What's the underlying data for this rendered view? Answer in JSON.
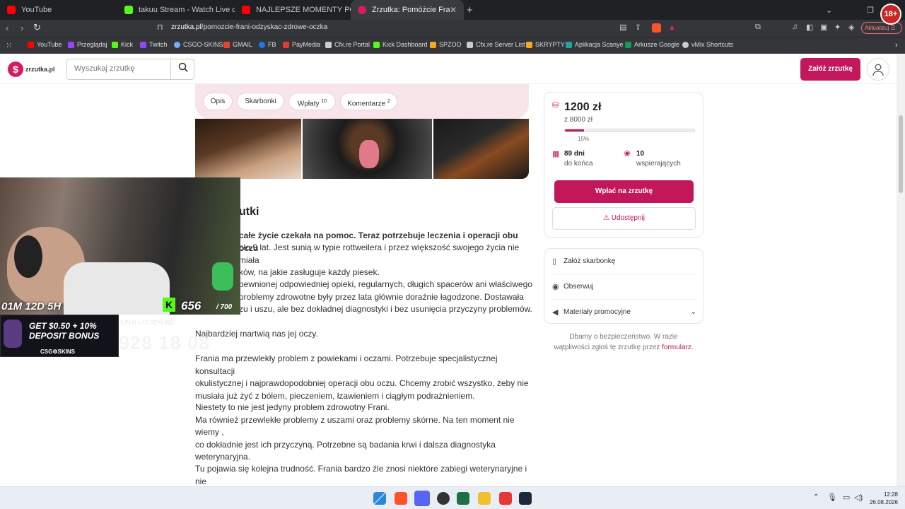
{
  "browser": {
    "tabs": [
      {
        "title": "YouTube",
        "color": "#ff0000"
      },
      {
        "title": "takuu Stream - Watch Live on Kick",
        "color": "#53fc18"
      },
      {
        "title": "NAJLEPSZE MOMENTY POLSKIEGO T",
        "color": "#ff0000"
      },
      {
        "title": "Zrzutka: Pomóżcie Frani odzysk",
        "color": "#d81b60"
      }
    ],
    "new_tab": "+",
    "url_host": "zrzutka.pl",
    "url_path": "/pomozcie-frani-odzyskac-zdrowe-oczka",
    "update_btn": "Aktualizuj",
    "age_badge": "18+",
    "bookmarks": [
      {
        "label": "YouTube",
        "color": "#ff0000"
      },
      {
        "label": "Przeglądaj",
        "color": "#9146ff"
      },
      {
        "label": "Kick",
        "color": "#53fc18"
      },
      {
        "label": "Twitch",
        "color": "#9146ff"
      },
      {
        "label": "CSGO-SKINS",
        "color": "#7aa7ff"
      },
      {
        "label": "GMAIL",
        "color": "#ea4335"
      },
      {
        "label": "FB",
        "color": "#1877f2"
      },
      {
        "label": "PayMedia",
        "color": "#e53935"
      },
      {
        "label": "Cfx.re Portal",
        "color": "#cccccc"
      },
      {
        "label": "Kick Dashboard",
        "color": "#53fc18"
      },
      {
        "label": "SPZOO",
        "color": "#f5a623"
      },
      {
        "label": "Cfx.re Server List",
        "color": "#cccccc"
      },
      {
        "label": "SKRYPTY",
        "color": "#f5a623"
      },
      {
        "label": "Aplikacja Scanye",
        "color": "#26a69a"
      },
      {
        "label": "Arkusze Google",
        "color": "#0f9d58"
      },
      {
        "label": "vMix Shortcuts",
        "color": "#cccccc"
      }
    ]
  },
  "site": {
    "logo_text": "zrzutka.pl",
    "search_placeholder": "Wyszukaj zrzutkę",
    "create_btn": "Załóż zrzutkę"
  },
  "tabs": [
    {
      "label": "Opis",
      "count": ""
    },
    {
      "label": "Skarbonki",
      "count": ""
    },
    {
      "label": "Wpłaty",
      "count": "10"
    },
    {
      "label": "Komentarze",
      "count": "2"
    }
  ],
  "article": {
    "title": "utki",
    "paragraphs": [
      {
        "bold": "całe życie czekała na pomoc. Teraz potrzebuje leczenia i operacji obu oczu",
        "text": "oło 9 lat. Jest sunią w typie rottweilera i przez większość swojego życia nie miała\nków, na jakie zasługuje każdy piesek."
      },
      {
        "bold": "",
        "text": "pewnionej odpowiedniej opieki, regularnych, długich spacerów ani właściwego\nproblemy zdrowotne były przez lata głównie doraźnie łagodzone. Dostawała\nzu i uszu, ale bez dokładnej diagnostyki i bez usunięcia przyczyny problemów."
      },
      {
        "bold": "",
        "text": "Najbardziej martwią nas jej oczy."
      },
      {
        "bold": "",
        "text": "Frania ma przewlekły problem z powiekami i oczami. Potrzebuje specjalistycznej konsultacji\nokulistycznej i najprawdopodobniej operacji obu oczu. Chcemy zrobić wszystko, żeby nie\nmusiała już żyć z bólem, pieczeniem, łzawieniem i ciągłym podrażnieniem."
      },
      {
        "bold": "",
        "text": "Niestety to nie jest jedyny problem zdrowotny Frani.\nMa również przewlekłe problemy z uszami oraz problemy skórne. Na ten moment nie wiemy ,\nco dokładnie jest ich przyczyną. Potrzebne są badania krwi i dalsza diagnostyka\nweterynaryjna."
      },
      {
        "bold": "",
        "text": "Tu pojawia się kolejna trudność. Frania bardzo źle znosi niektóre zabiegi weterynaryjne i nie\npozwala spokojnie pobrać sobie krwi. Dlatego najprawdopodobniej także do pobrania krwi i"
      }
    ]
  },
  "donation": {
    "amount": "1200 zł",
    "goal": "z 8000 zł",
    "progress_pct": 15,
    "progress_label": "15%",
    "days_num": "89 dni",
    "days_lbl": "do końca",
    "supporters_num": "10",
    "supporters_lbl": "wspierających",
    "pay_btn": "Wpłać na zrzutkę",
    "share_btn": "Udostępnij"
  },
  "actions": {
    "piggy": "Załóż skarbonkę",
    "watch": "Obserwuj",
    "promo": "Materiały promocyjne"
  },
  "safety": {
    "text": "Dbamy o bezpieczeństwo. W razie wątpliwości zgłoś tę zrzutkę przez",
    "link": "formularz",
    "end": "."
  },
  "overlay": {
    "timer": "01M 12D 5H",
    "kick_count": "656",
    "kick_total": "/ 700",
    "banner_line1": "GET $0.50 + 10%",
    "banner_line2": "DEPOSIT BONUS",
    "banner_brand": "CSG⚙SKINS",
    "ghost_small": "1 PLN = 10 SEKUND",
    "ghost_big": "928 18 08"
  },
  "taskbar": {
    "time": "12:28",
    "date": "26.08.2026"
  }
}
